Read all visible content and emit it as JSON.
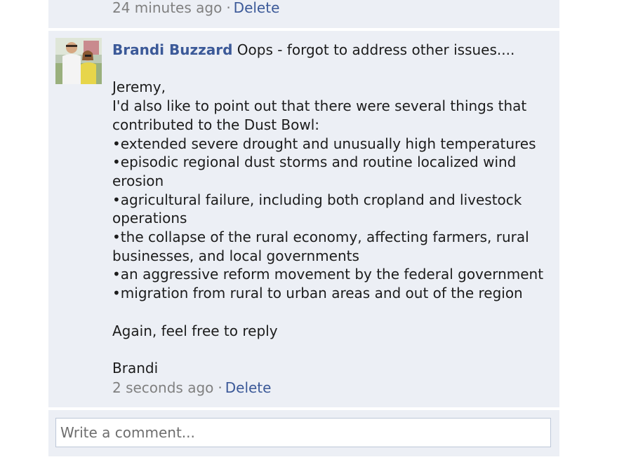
{
  "previous_comment": {
    "timestamp": "24 minutes ago",
    "separator": "·",
    "delete_label": "Delete"
  },
  "comment": {
    "author": "Brandi Buzzard",
    "first_line": "Oops - forgot to address other issues....",
    "lines": [
      "",
      "Jeremy,",
      "I'd also like to point out that there were several things that",
      "contributed to the Dust Bowl:",
      "•extended severe drought and unusually high temperatures",
      "•episodic regional dust storms and routine localized wind",
      "erosion",
      "•agricultural failure, including both cropland and livestock",
      "operations",
      "•the collapse of the rural economy, affecting farmers, rural",
      "businesses, and local governments",
      "•an aggressive reform movement by the federal government",
      "•migration from rural to urban areas and out of the region",
      "",
      "Again, feel free to reply",
      "",
      "Brandi"
    ],
    "timestamp": "2 seconds ago",
    "separator": "·",
    "delete_label": "Delete"
  },
  "composer": {
    "placeholder": "Write a comment..."
  }
}
